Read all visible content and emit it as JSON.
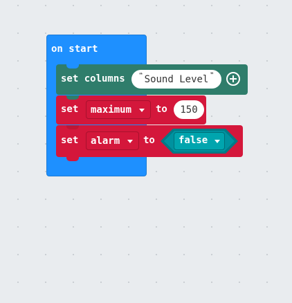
{
  "workspace": {
    "hat_block": {
      "label": "on start"
    },
    "set_columns_block": {
      "label": "set columns",
      "value": "Sound Level",
      "add_icon": "plus-circle-icon"
    },
    "set_maximum_block": {
      "set_label": "set",
      "variable": "maximum",
      "to_label": "to",
      "value": "150"
    },
    "set_alarm_block": {
      "set_label": "set",
      "variable": "alarm",
      "to_label": "to",
      "value": "false"
    }
  },
  "colors": {
    "hat": "#1e90ff",
    "datalogger": "#2f7d6b",
    "variables": "#d4173b",
    "logic": "#00929f"
  }
}
